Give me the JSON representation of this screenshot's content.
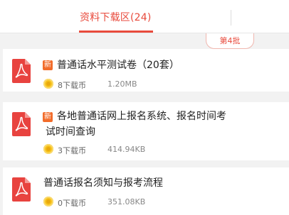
{
  "header": {
    "tab_label": "资料下载区(24)"
  },
  "batch_label": "第4批",
  "new_badge_text": "新",
  "items": [
    {
      "title_lines": [
        "普通话水平测试卷（20套）"
      ],
      "is_new": true,
      "price": "8下载币",
      "size": "1.20MB"
    },
    {
      "title_lines": [
        "各地普通话网上报名系统、报名时间考",
        "试时间查询"
      ],
      "is_new": true,
      "price": "3下载币",
      "size": "414.94KB"
    },
    {
      "title_lines": [
        "普通话报名须知与报考流程"
      ],
      "is_new": false,
      "price": "0下载币",
      "size": "351.08KB"
    }
  ],
  "colors": {
    "accent": "#e84a3c",
    "new_badge": "#f26c2b",
    "coin": "#f7c21a",
    "pdf_icon": "#e8433f"
  }
}
